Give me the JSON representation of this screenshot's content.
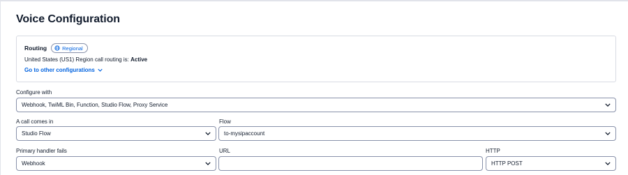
{
  "page": {
    "title": "Voice Configuration"
  },
  "routing": {
    "label": "Routing",
    "badge": "Regional",
    "status_prefix": "United States (US1) Region call routing is:",
    "status_value": "Active",
    "link": "Go to other configurations"
  },
  "configure_with": {
    "label": "Configure with",
    "value": "Webhook, TwiML Bin, Function, Studio Flow, Proxy Service"
  },
  "call_comes_in": {
    "label": "A call comes in",
    "value": "Studio Flow"
  },
  "flow": {
    "label": "Flow",
    "value": "to-mysipaccount"
  },
  "primary_handler": {
    "label": "Primary handler fails",
    "value": "Webhook"
  },
  "url": {
    "label": "URL",
    "value": ""
  },
  "http": {
    "label": "HTTP",
    "value": "HTTP POST"
  },
  "colors": {
    "link_blue": "#0263e0",
    "text": "#121c2d",
    "border": "#8891aa"
  }
}
